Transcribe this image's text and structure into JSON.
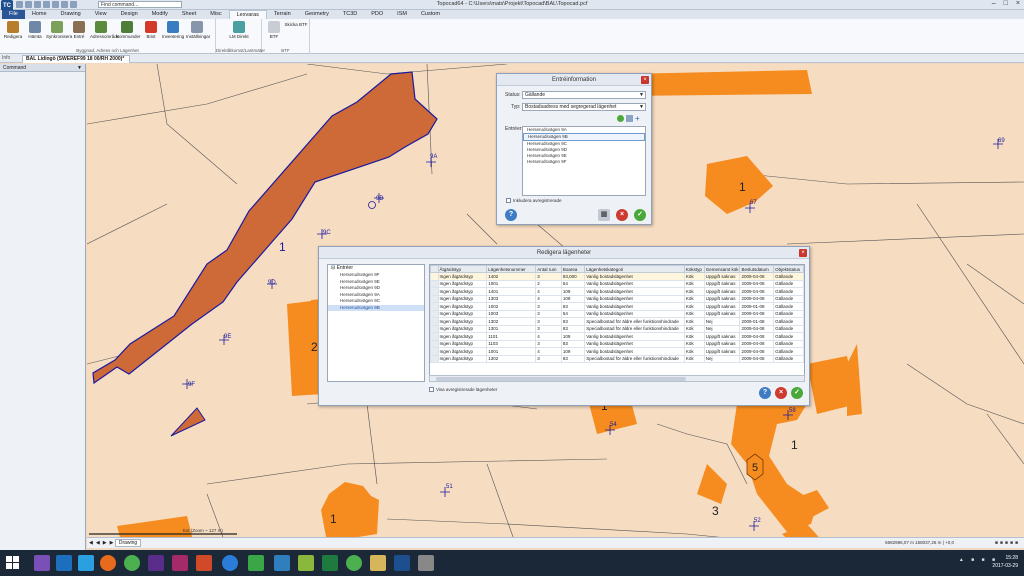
{
  "window": {
    "title": "Topocad64 - C:\\Users\\mats\\Projekt\\Topocad\\BAL\\Topocad.pcf",
    "logo": "TC",
    "command_placeholder": "Find command..."
  },
  "ribbon_tabs": [
    "File",
    "Home",
    "Drawing",
    "View",
    "Design",
    "Modify",
    "Sheet",
    "Misc",
    "Lexvaras",
    "Terrain",
    "Geometry",
    "TC3D",
    "PDO",
    "ISM",
    "Custom"
  ],
  "ribbon": {
    "group1": {
      "label": "Byggnad, Adress och Lägenhet",
      "buttons": [
        "Redigera",
        "Hämta",
        "Synkronisera",
        "Entré",
        "Adressområde",
        "Kommunder",
        "Brist",
        "Inventering",
        "Inställningar"
      ]
    },
    "group2": {
      "label": "Direktåtkomst/Lantmäter",
      "buttons": [
        "LM Direkt"
      ]
    },
    "group3": {
      "label": "BTF",
      "buttons": [
        "BTF",
        "Skicka BTF"
      ]
    }
  },
  "doc": {
    "home_tab": "Info",
    "tab": "BAL Lidingö (SWEREF99 18 00/RH 2000)*"
  },
  "left_panel": {
    "title": "Command"
  },
  "map": {
    "building_labels": [
      "1",
      "2",
      "1",
      "1",
      "1",
      "1",
      "5",
      "3"
    ],
    "point_labels": [
      "9A",
      "9B",
      "9C",
      "9D",
      "9E",
      "9F",
      "69",
      "67",
      "54",
      "58",
      "51",
      "52"
    ],
    "scale_text": "Ext (Zoom ~ 127 m)"
  },
  "status": {
    "drawing_tab": "Drawing",
    "coords": "6682986,07 m 158037,26 m | +0,0",
    "date": "2017-03-29",
    "time": "15:28"
  },
  "entre_dialog": {
    "title": "Entréinformation",
    "status_label": "Status:",
    "status_value": "Gällande",
    "type_label": "Typ:",
    "type_value": "Bostadsadress med segregerad lägenhet",
    "entries_label": "Entréer:",
    "entries": [
      "Herserudsvägen 9A",
      "Herserudsvägen 9B",
      "Herserudsvägen 9C",
      "Herserudsvägen 9D",
      "Herserudsvägen 9E",
      "Herserudsvägen 9F"
    ],
    "include_label": "Inkludera avregistrerade"
  },
  "lag_dialog": {
    "title": "Redigera lägenheter",
    "tree_root": "Entréer",
    "tree_items": [
      "Herserudsvägen 9F",
      "Herserudsvägen 9E",
      "Herserudsvägen 9D",
      "Herserudsvägen 9A",
      "Herserudsvägen 9C",
      "Herserudsvägen 9B"
    ],
    "columns": [
      "Åtgärdstyp",
      "Lägenhetsnummer",
      "Antal rum",
      "Boarea",
      "Lägenhetskategori",
      "Kökstyp",
      "Gemensamt kök",
      "Beslutsdatum",
      "Objektstatus"
    ],
    "rows": [
      [
        "Ingen åtgärdstyp",
        "1402",
        "3",
        "83,000",
        "Vanlig bostadslägenhet",
        "Kök",
        "Uppgift saknas",
        "2009-04-08",
        "Gällande"
      ],
      [
        "Ingen åtgärdstyp",
        "1001",
        "2",
        "54",
        "Vanlig bostadslägenhet",
        "Kök",
        "Uppgift saknas",
        "2009-04-08",
        "Gällande"
      ],
      [
        "Ingen åtgärdstyp",
        "1401",
        "4",
        "109",
        "Vanlig bostadslägenhet",
        "Kök",
        "Uppgift saknas",
        "2009-04-08",
        "Gällande"
      ],
      [
        "Ingen åtgärdstyp",
        "1303",
        "4",
        "109",
        "Vanlig bostadslägenhet",
        "Kök",
        "Uppgift saknas",
        "2009-04-08",
        "Gällande"
      ],
      [
        "Ingen åtgärdstyp",
        "1002",
        "3",
        "83",
        "Vanlig bostadslägenhet",
        "Kök",
        "Uppgift saknas",
        "2009-01-08",
        "Gällande"
      ],
      [
        "Ingen åtgärdstyp",
        "1003",
        "3",
        "54",
        "Vanlig bostadslägenhet",
        "Kök",
        "Uppgift saknas",
        "2009-04-08",
        "Gällande"
      ],
      [
        "Ingen åtgärdstyp",
        "1302",
        "3",
        "83",
        "Specialbostad för äldre eller funktionshindrade",
        "Kök",
        "Nej",
        "2009-01-08",
        "Gällande"
      ],
      [
        "Ingen åtgärdstyp",
        "1301",
        "3",
        "83",
        "Specialbostad för äldre eller funktionshindrade",
        "Kök",
        "Nej",
        "2009-04-08",
        "Gällande"
      ],
      [
        "Ingen åtgärdstyp",
        "1101",
        "4",
        "109",
        "Vanlig bostadslägenhet",
        "Kök",
        "Uppgift saknas",
        "2009-04-08",
        "Gällande"
      ],
      [
        "Ingen åtgärdstyp",
        "1103",
        "3",
        "83",
        "Vanlig bostadslägenhet",
        "Kök",
        "Uppgift saknas",
        "2009-04-08",
        "Gällande"
      ],
      [
        "Ingen åtgärdstyp",
        "1001",
        "4",
        "109",
        "Vanlig bostadslägenhet",
        "Kök",
        "Uppgift saknas",
        "2009-04-08",
        "Gällande"
      ],
      [
        "Ingen åtgärdstyp",
        "1302",
        "3",
        "83",
        "Specialbostad för äldre eller funktionshindrade",
        "Kök",
        "Nej",
        "2009-04-08",
        "Gällande"
      ]
    ],
    "show_removed_label": "Visa avregistrerade lägenheter"
  },
  "colors": {
    "map_bg": "#f6dcc1",
    "building": "#f68c1f",
    "selected_building": "#cd6a37",
    "building_outline": "#1a1aa0",
    "title_accent": "#2b5797"
  },
  "icons": [
    "help-icon",
    "cancel-icon",
    "ok-icon",
    "add-icon",
    "close-icon"
  ]
}
